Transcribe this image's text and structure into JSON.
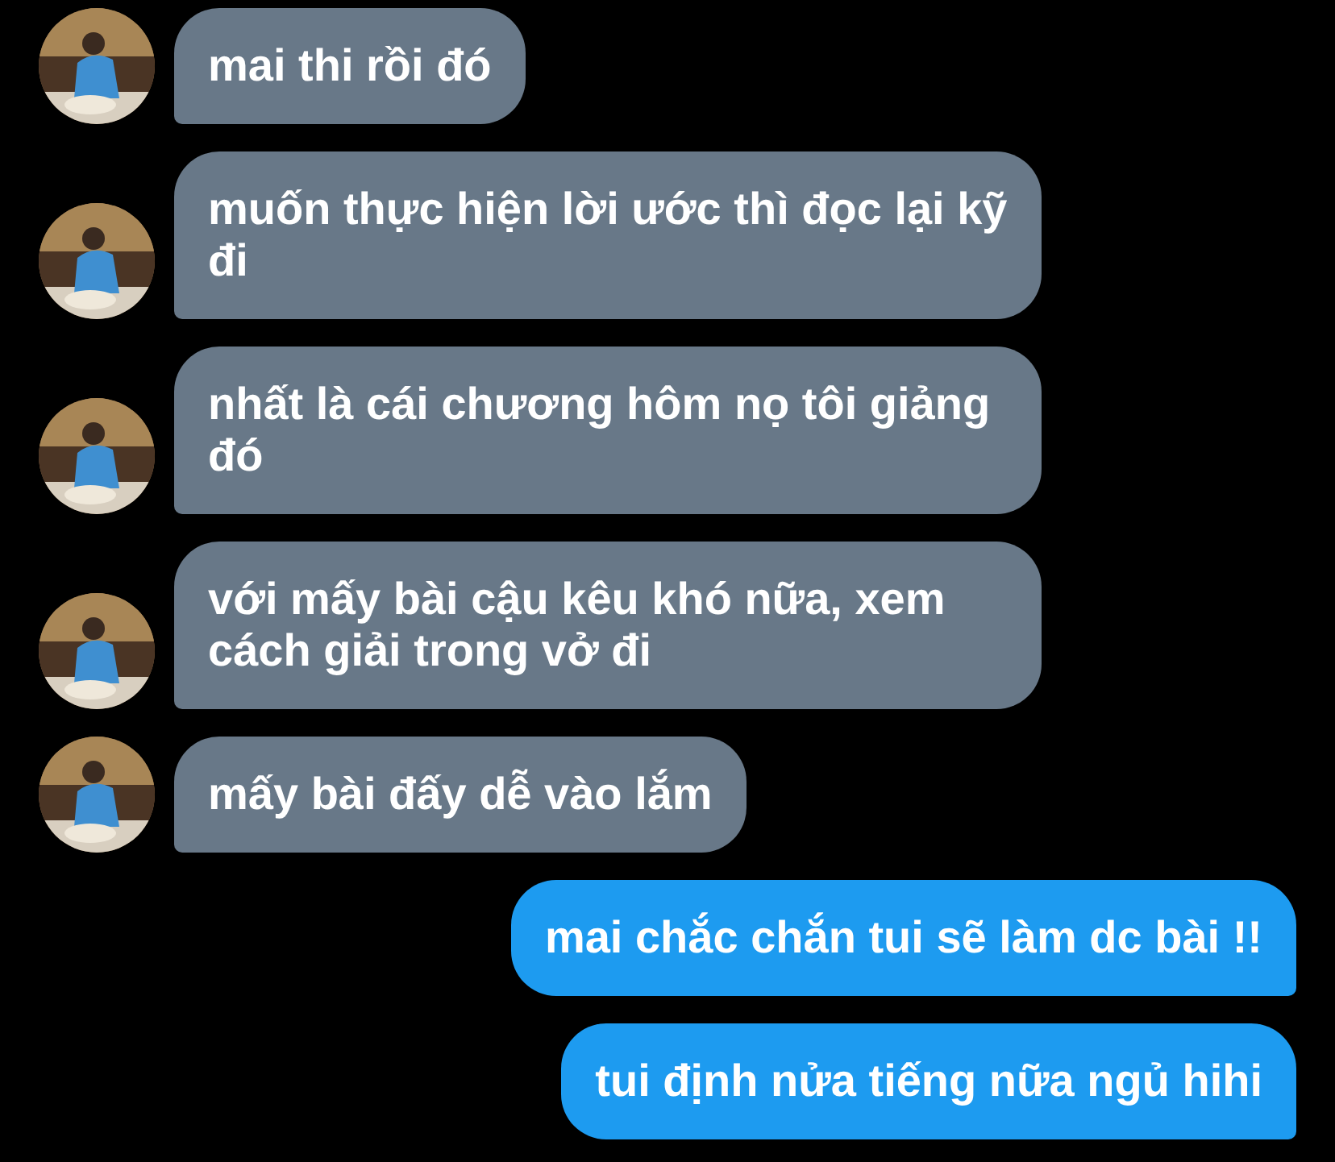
{
  "messages": [
    {
      "kind": "incoming",
      "text": "mai thi rồi đó"
    },
    {
      "kind": "incoming",
      "text": "muốn thực hiện lời ước thì đọc lại kỹ đi"
    },
    {
      "kind": "incoming",
      "text": "nhất là cái chương hôm nọ tôi giảng đó"
    },
    {
      "kind": "incoming",
      "text": "với mấy bài cậu kêu khó nữa, xem cách giải trong vở đi"
    },
    {
      "kind": "incoming",
      "text": "mấy bài đấy dễ vào lắm"
    },
    {
      "kind": "outgoing",
      "text": "mai chắc chắn tui sẽ làm dc bài !!"
    },
    {
      "kind": "outgoing",
      "text": "tui định nửa tiếng nữa ngủ hihi"
    }
  ]
}
